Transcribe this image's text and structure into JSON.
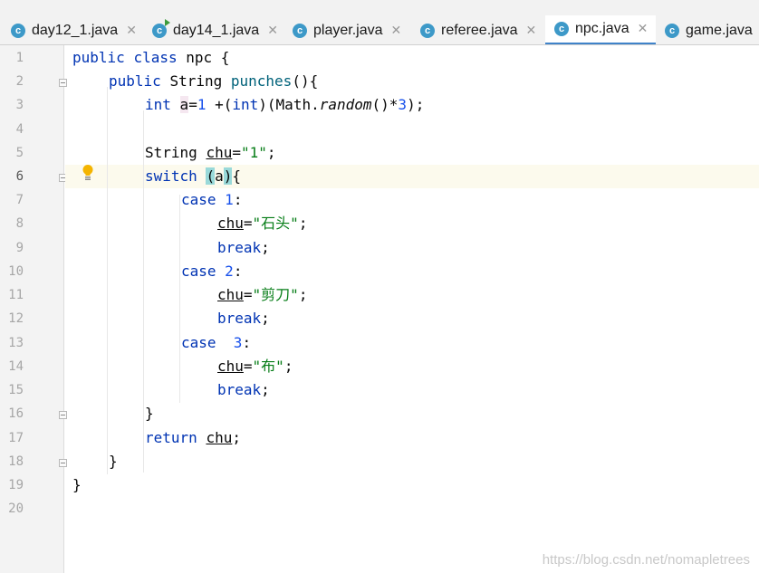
{
  "tabs": [
    {
      "label": "day12_1.java",
      "icon": "java-class-icon",
      "icon_letter": "c",
      "active": false
    },
    {
      "label": "day14_1.java",
      "icon": "java-runnable-class-icon",
      "icon_letter": "c",
      "active": false
    },
    {
      "label": "player.java",
      "icon": "java-class-icon",
      "icon_letter": "c",
      "active": false
    },
    {
      "label": "referee.java",
      "icon": "java-class-icon",
      "icon_letter": "c",
      "active": false
    },
    {
      "label": "npc.java",
      "icon": "java-class-icon",
      "icon_letter": "c",
      "active": true
    },
    {
      "label": "game.java",
      "icon": "java-class-icon",
      "icon_letter": "c",
      "active": false
    }
  ],
  "close_glyph": "✕",
  "line_numbers": [
    "1",
    "2",
    "3",
    "4",
    "5",
    "6",
    "7",
    "8",
    "9",
    "10",
    "11",
    "12",
    "13",
    "14",
    "15",
    "16",
    "17",
    "18",
    "19",
    "20"
  ],
  "current_line": "6",
  "code": {
    "l1_kw1": "public",
    "l1_kw2": "class",
    "l1_name": "npc",
    "l1_brace": "{",
    "l2_kw1": "public",
    "l2_type": "String",
    "l2_fn": "punches",
    "l2_rest": "(){",
    "l3_kw": "int",
    "l3_var": "a",
    "l3_eq": "=",
    "l3_n1": "1",
    "l3_plus": " +(",
    "l3_kw2": "int",
    "l3_cls": ")(Math.",
    "l3_method": "random",
    "l3_mul": "()*",
    "l3_n3": "3",
    "l3_end": ");",
    "l5_type": "String",
    "l5_var": "chu",
    "l5_eq": "=",
    "l5_str": "\"1\"",
    "l5_end": ";",
    "l6_kw": "switch",
    "l6_paren_open": "(",
    "l6_var": "a",
    "l6_paren_close": ")",
    "l6_brace": "{",
    "case_kw": "case",
    "l7_n": "1",
    "l10_n": "2",
    "l13_n": "3",
    "colon": ":",
    "chu": "chu",
    "eq": "=",
    "l8_str": "\"石头\"",
    "l11_str": "\"剪刀\"",
    "l14_str": "\"布\"",
    "semi": ";",
    "break_kw": "break",
    "close_brace": "}",
    "return_kw": "return",
    "return_var": "chu"
  },
  "watermark": "https://blog.csdn.net/nomapletrees",
  "colors": {
    "keyword": "#0033b3",
    "number": "#1750eb",
    "string": "#067d17",
    "method": "#00627a",
    "caret_row": "#fcfaed",
    "tab_underline": "#4083c9",
    "class_icon": "#3d99c8"
  }
}
